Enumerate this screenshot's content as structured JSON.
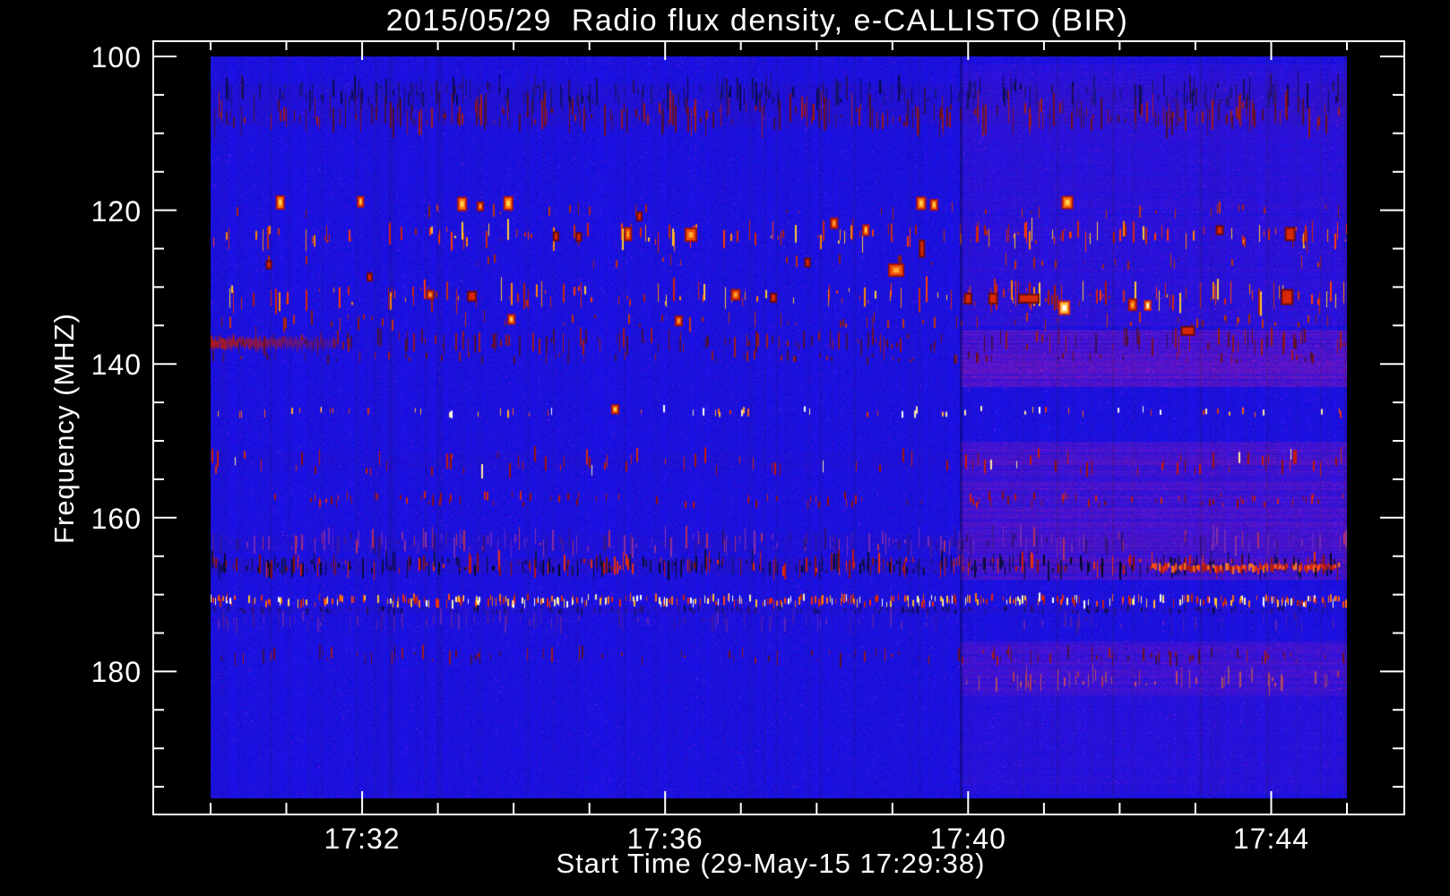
{
  "page": {
    "background": "#000000",
    "text_color": "#ffffff"
  },
  "chart_data": {
    "type": "heatmap",
    "variant": "radio-spectrogram",
    "title": "2015/05/29  Radio flux density, e-CALLISTO (BIR)",
    "xlabel": "Start Time (29-May-15 17:29:38)",
    "ylabel": "Frequency (MHZ)",
    "legend": "none",
    "grid": false,
    "x_axis": {
      "unit": "time",
      "range_min": [
        0,
        15
      ],
      "start_time_label": "17:29:38",
      "major_tick_labels": [
        "17:32",
        "17:36",
        "17:40",
        "17:44"
      ],
      "major_tick_minutes": [
        2,
        6,
        10,
        14
      ],
      "minor_step_min": 1
    },
    "y_axis": {
      "unit": "MHz",
      "range": [
        100,
        196.5
      ],
      "increases_downward": true,
      "major_tick_labels": [
        "100",
        "120",
        "140",
        "160",
        "180"
      ],
      "major_tick_values": [
        100,
        120,
        140,
        160,
        180
      ],
      "minor_step": 5,
      "minor_max": 195
    },
    "colors": {
      "page_bg": "#000000",
      "frame": "#ffffff",
      "text": "#ffffff",
      "background_blue": "#1612e0",
      "burst_hot": "#ffd850",
      "burst_red": "#d42408"
    },
    "right_section": {
      "start_min": 9.9,
      "tint_rows": [
        {
          "f1": 101,
          "f2": 135,
          "amp": 16
        },
        {
          "f1": 135.5,
          "f2": 143,
          "amp": 55
        },
        {
          "f1": 150,
          "f2": 168,
          "amp": 42
        },
        {
          "f1": 176,
          "f2": 183,
          "amp": 38
        },
        {
          "f1": 183,
          "f2": 196,
          "amp": 12
        }
      ]
    },
    "dark_rows": [
      {
        "f1": 103.3,
        "f2": 109.0,
        "amt": 0.1
      },
      {
        "f1": 151.6,
        "f2": 153.6,
        "amt": 0.06
      },
      {
        "f1": 162.2,
        "f2": 164.4,
        "amt": 0.08
      },
      {
        "f1": 165.2,
        "f2": 167.2,
        "amt": 0.12
      },
      {
        "f1": 171.6,
        "f2": 172.4,
        "amt": 0.08
      }
    ],
    "palettes": {
      "dark_faint": [
        "#0a0a4a",
        "#141060",
        "#2a1060",
        "#1a1480"
      ],
      "maroon": [
        "#6e1020",
        "#8c1822",
        "#4c1034",
        "#a01c18",
        "#3c1050"
      ],
      "red_faint": [
        "#a82410",
        "#c23410",
        "#841c18"
      ],
      "red_mix": [
        "#d42408",
        "#a81c08",
        "#ff3c00",
        "#c62c10",
        "#ff8400",
        "#ffc830"
      ],
      "red_dash": [
        "#c41c08",
        "#a01408",
        "#d42c10",
        "#8c1008",
        "#c41c08",
        "#ffe9a0",
        "#c41c08",
        "#a01408"
      ],
      "red_dash2": [
        "#b81808",
        "#941008",
        "#d42410",
        "#841010"
      ],
      "bright_sparse": [
        "#ffffff",
        "#ffe9a0",
        "#ffb030",
        "#ff6010",
        "#e03008"
      ],
      "purple_mix": [
        "#5a20c8",
        "#7428b8",
        "#40189c",
        "#8c30a0",
        "#b03060",
        "#321078"
      ],
      "dark_red_mix": [
        "#05051e",
        "#0c0c3c",
        "#141452",
        "#0a0a30",
        "#c41808",
        "#e83008",
        "#841010",
        "#0c0c3c"
      ],
      "bright_dense": [
        "#ffffff",
        "#fff0a8",
        "#ffc030",
        "#ff7010",
        "#e82808",
        "#c02008",
        "#ff4808"
      ],
      "purple_faint": [
        "#4a1cb0",
        "#3c16a0",
        "#5c24b4"
      ],
      "pink_row": [
        "#c04868",
        "#a83858",
        "#904878",
        "#b05060"
      ],
      "streak_red": [
        "#e02808",
        "#ff5010",
        "#b81c08",
        "#ff7c20"
      ]
    },
    "rfi_bands": [
      {
        "f": 104.8,
        "hw": 1.1,
        "density": 0.3,
        "palette": "dark_faint"
      },
      {
        "f": 107.6,
        "hw": 1.3,
        "density": 0.4,
        "palette": "maroon"
      },
      {
        "f": 120.0,
        "hw": 0.5,
        "density": 0.05,
        "palette": "red_faint"
      },
      {
        "f": 123.3,
        "hw": 0.9,
        "density": 0.2,
        "palette": "red_mix",
        "right_boost": 1.5
      },
      {
        "f": 126.8,
        "hw": 0.5,
        "density": 0.06,
        "palette": "red_faint"
      },
      {
        "f": 131.2,
        "hw": 1.0,
        "density": 0.22,
        "palette": "red_mix",
        "right_boost": 1.5
      },
      {
        "f": 134.4,
        "hw": 0.6,
        "density": 0.1,
        "palette": "red_faint"
      },
      {
        "f": 137.1,
        "hw": 0.8,
        "density": 0.25,
        "palette": "maroon",
        "left_segment": [
          0,
          1.7
        ]
      },
      {
        "f": 139.2,
        "hw": 0.4,
        "density": 0.1,
        "palette": "maroon"
      },
      {
        "f": 146.2,
        "hw": 0.4,
        "density": 0.1,
        "palette": "bright_sparse",
        "dh": [
          4,
          9
        ]
      },
      {
        "f": 152.8,
        "hw": 1.2,
        "density": 0.14,
        "palette": "red_dash",
        "dh": [
          6,
          18
        ]
      },
      {
        "f": 157.7,
        "hw": 0.7,
        "density": 0.14,
        "palette": "red_dash2",
        "dh": [
          4,
          10
        ],
        "right_boost": 1.5
      },
      {
        "f": 163.2,
        "hw": 0.9,
        "density": 0.28,
        "palette": "purple_mix"
      },
      {
        "f": 166.2,
        "hw": 0.8,
        "density": 0.5,
        "palette": "dark_red_mix",
        "right_streak": [
          12.4,
          14.9
        ]
      },
      {
        "f": 170.8,
        "hw": 0.5,
        "density": 0.55,
        "palette": "bright_dense",
        "dh": [
          5,
          10
        ]
      },
      {
        "f": 172.0,
        "hw": 0.3,
        "density": 0.3,
        "palette": "dark_faint"
      },
      {
        "f": 173.5,
        "hw": 0.7,
        "density": 0.18,
        "palette": "purple_faint"
      },
      {
        "f": 178.0,
        "hw": 0.6,
        "density": 0.12,
        "palette": "maroon",
        "right_boost": 2.0
      },
      {
        "f": 181.0,
        "hw": 0.8,
        "density": 0.22,
        "palette": "pink_row",
        "right_only": true
      }
    ],
    "bursts": [
      {
        "t": 0.92,
        "f": 119.0,
        "w": 6,
        "h": 12,
        "k": "yellow"
      },
      {
        "t": 1.98,
        "f": 118.9,
        "w": 4,
        "h": 9,
        "k": "yellow"
      },
      {
        "t": 0.77,
        "f": 127.1,
        "w": 3,
        "h": 6,
        "k": "red"
      },
      {
        "t": 2.1,
        "f": 128.7,
        "w": 3,
        "h": 6,
        "k": "red"
      },
      {
        "t": 2.9,
        "f": 131.0,
        "w": 5,
        "h": 7,
        "k": "orange"
      },
      {
        "t": 3.32,
        "f": 119.2,
        "w": 7,
        "h": 12,
        "k": "yellow"
      },
      {
        "t": 3.45,
        "f": 131.2,
        "w": 7,
        "h": 8,
        "k": "red"
      },
      {
        "t": 3.56,
        "f": 119.5,
        "w": 4,
        "h": 7,
        "k": "orange"
      },
      {
        "t": 3.93,
        "f": 119.1,
        "w": 7,
        "h": 12,
        "k": "yellow"
      },
      {
        "t": 3.97,
        "f": 134.2,
        "w": 5,
        "h": 8,
        "k": "yellow"
      },
      {
        "t": 4.56,
        "f": 123.4,
        "w": 3,
        "h": 7,
        "k": "red"
      },
      {
        "t": 4.86,
        "f": 123.5,
        "w": 3,
        "h": 7,
        "k": "red"
      },
      {
        "t": 5.34,
        "f": 145.9,
        "w": 5,
        "h": 7,
        "k": "yellow"
      },
      {
        "t": 5.51,
        "f": 123.1,
        "w": 5,
        "h": 12,
        "k": "orange"
      },
      {
        "t": 5.66,
        "f": 120.8,
        "w": 3,
        "h": 7,
        "k": "red"
      },
      {
        "t": 6.18,
        "f": 134.4,
        "w": 5,
        "h": 8,
        "k": "orange"
      },
      {
        "t": 6.34,
        "f": 123.2,
        "w": 10,
        "h": 12,
        "k": "orange"
      },
      {
        "t": 6.93,
        "f": 131.0,
        "w": 7,
        "h": 9,
        "k": "orange"
      },
      {
        "t": 7.43,
        "f": 131.4,
        "w": 4,
        "h": 7,
        "k": "red"
      },
      {
        "t": 7.88,
        "f": 126.8,
        "w": 3,
        "h": 7,
        "k": "red"
      },
      {
        "t": 8.23,
        "f": 121.7,
        "w": 5,
        "h": 9,
        "k": "orange"
      },
      {
        "t": 8.65,
        "f": 122.6,
        "w": 4,
        "h": 9,
        "k": "yellow"
      },
      {
        "t": 9.05,
        "f": 127.8,
        "w": 14,
        "h": 11,
        "k": "orange"
      },
      {
        "t": 9.38,
        "f": 119.1,
        "w": 7,
        "h": 11,
        "k": "yellow"
      },
      {
        "t": 9.55,
        "f": 119.3,
        "w": 5,
        "h": 9,
        "k": "yellow"
      },
      {
        "t": 9.39,
        "f": 125.0,
        "w": 3,
        "h": 16,
        "k": "red"
      },
      {
        "t": 10.0,
        "f": 131.5,
        "w": 5,
        "h": 9,
        "k": "red"
      },
      {
        "t": 10.33,
        "f": 131.5,
        "w": 7,
        "h": 9,
        "k": "red"
      },
      {
        "t": 10.8,
        "f": 131.5,
        "w": 20,
        "h": 7,
        "k": "red"
      },
      {
        "t": 11.27,
        "f": 132.7,
        "w": 9,
        "h": 12,
        "k": "white"
      },
      {
        "t": 11.31,
        "f": 119.0,
        "w": 9,
        "h": 11,
        "k": "yellow"
      },
      {
        "t": 12.17,
        "f": 132.3,
        "w": 6,
        "h": 10,
        "k": "orange"
      },
      {
        "t": 12.37,
        "f": 132.4,
        "w": 4,
        "h": 8,
        "k": "white"
      },
      {
        "t": 12.9,
        "f": 135.7,
        "w": 12,
        "h": 7,
        "k": "red"
      },
      {
        "t": 13.32,
        "f": 122.6,
        "w": 5,
        "h": 7,
        "k": "red"
      },
      {
        "t": 14.25,
        "f": 123.1,
        "w": 8,
        "h": 12,
        "k": "red"
      },
      {
        "t": 14.21,
        "f": 131.3,
        "w": 10,
        "h": 14,
        "k": "red"
      }
    ],
    "burst_palettes": {
      "yellow": [
        "#b81808",
        "#ff7c10",
        "#ffd850"
      ],
      "orange": [
        "#a01408",
        "#ee5008",
        "#ffaa30"
      ],
      "red": [
        "#6e0c08",
        "#d82808"
      ],
      "white": [
        "#d83008",
        "#ffc040",
        "#ffffff"
      ]
    }
  }
}
